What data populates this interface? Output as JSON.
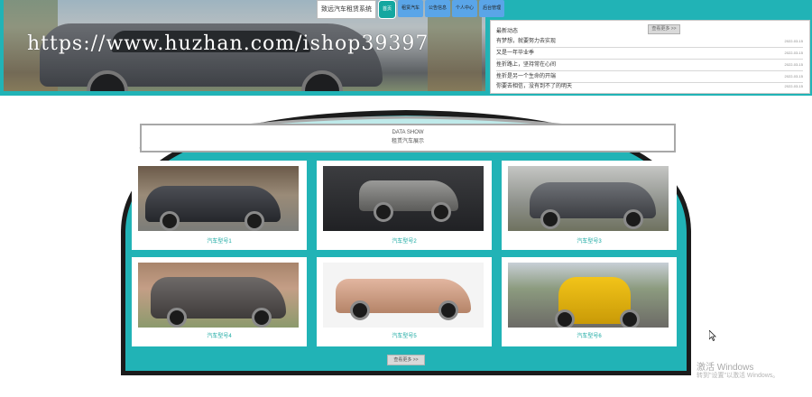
{
  "nav": {
    "title": "致远汽车租赁系统",
    "items": [
      {
        "label": "首页",
        "active": true
      },
      {
        "label": "租赁汽车",
        "active": false
      },
      {
        "label": "公告信息",
        "active": false
      },
      {
        "label": "个人中心",
        "active": false
      },
      {
        "label": "后台管理",
        "active": false
      }
    ]
  },
  "watermark_text": "https://www.huzhan.com/ishop39397",
  "news": {
    "heading": "最新动态",
    "more_label": "查看更多 >>",
    "items": [
      {
        "title": "有梦想，就要努力去实现",
        "date": "2022-03-15"
      },
      {
        "title": "又是一年毕业季",
        "date": "2022-03-15"
      },
      {
        "title": "挫折路上，坚持常在心间",
        "date": "2022-03-15"
      },
      {
        "title": "挫折是另一个生命的开端",
        "date": "2022-03-15"
      },
      {
        "title": "你要去相信，没有到不了的明天",
        "date": "2022-03-15"
      }
    ]
  },
  "showcase": {
    "title_en": "DATA SHOW",
    "title_cn": "租赁汽车展示",
    "more_label": "查看更多 >>",
    "cars": [
      {
        "label": "汽车型号1"
      },
      {
        "label": "汽车型号2"
      },
      {
        "label": "汽车型号3"
      },
      {
        "label": "汽车型号4"
      },
      {
        "label": "汽车型号5"
      },
      {
        "label": "汽车型号6"
      }
    ]
  },
  "windows_activation": {
    "title": "激活 Windows",
    "subtitle": "转到\"设置\"以激活 Windows。"
  },
  "colors": {
    "accent": "#21b3b6",
    "nav_blue": "#5aa5e8",
    "caption": "#14a7a0"
  }
}
